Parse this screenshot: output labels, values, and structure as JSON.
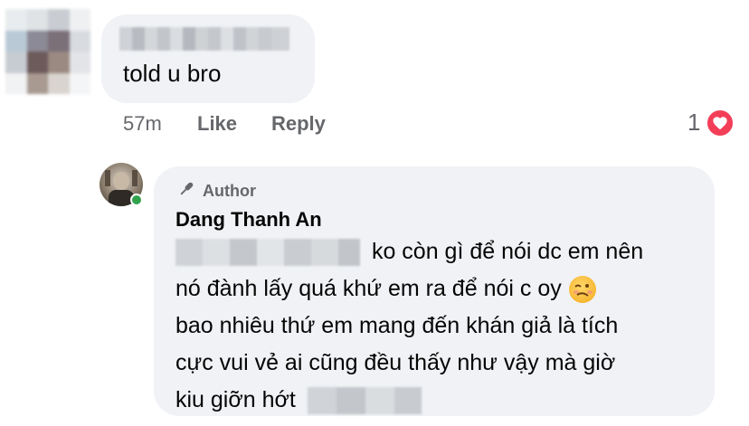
{
  "comment1": {
    "text": "told u bro",
    "time": "57m",
    "like_label": "Like",
    "reply_label": "Reply",
    "reaction_count": "1",
    "reaction_icon": "heart-icon",
    "reaction_color": "#f33e58"
  },
  "comment2": {
    "badge_label": "Author",
    "badge_icon": "microphone-icon",
    "author_name": "Dang Thanh An",
    "lines": [
      "ko còn gì để nói dc em nên",
      "nó đành lấy quá khứ em ra để nói c oy",
      "bao nhiêu thứ em mang đến khán giả là tích",
      "cực vui vẻ ai cũng đều thấy như vậy mà giờ",
      "kiu giỡn hớt"
    ],
    "emoji": "woozy-face-emoji",
    "online_status_color": "#31a24c"
  },
  "colors": {
    "bubble": "#f0f2f5",
    "meta_text": "#65676b",
    "primary_text": "#050505"
  }
}
